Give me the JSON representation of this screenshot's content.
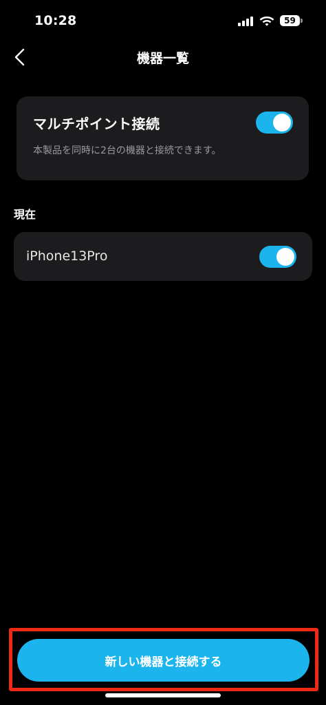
{
  "status_bar": {
    "time": "10:28",
    "battery": "59"
  },
  "nav": {
    "title": "機器一覧",
    "back_icon": "chevron-left-icon"
  },
  "multipoint": {
    "title": "マルチポイント接続",
    "description": "本製品を同時に2台の機器と接続できます。",
    "enabled": true
  },
  "current": {
    "label": "現在",
    "device_name": "iPhone13Pro",
    "connected": true
  },
  "connect_button": {
    "label": "新しい機器と接続する"
  },
  "colors": {
    "accent": "#1cb4ec",
    "highlight": "#ee2a13",
    "card": "#1c1c1e",
    "background": "#000000"
  }
}
